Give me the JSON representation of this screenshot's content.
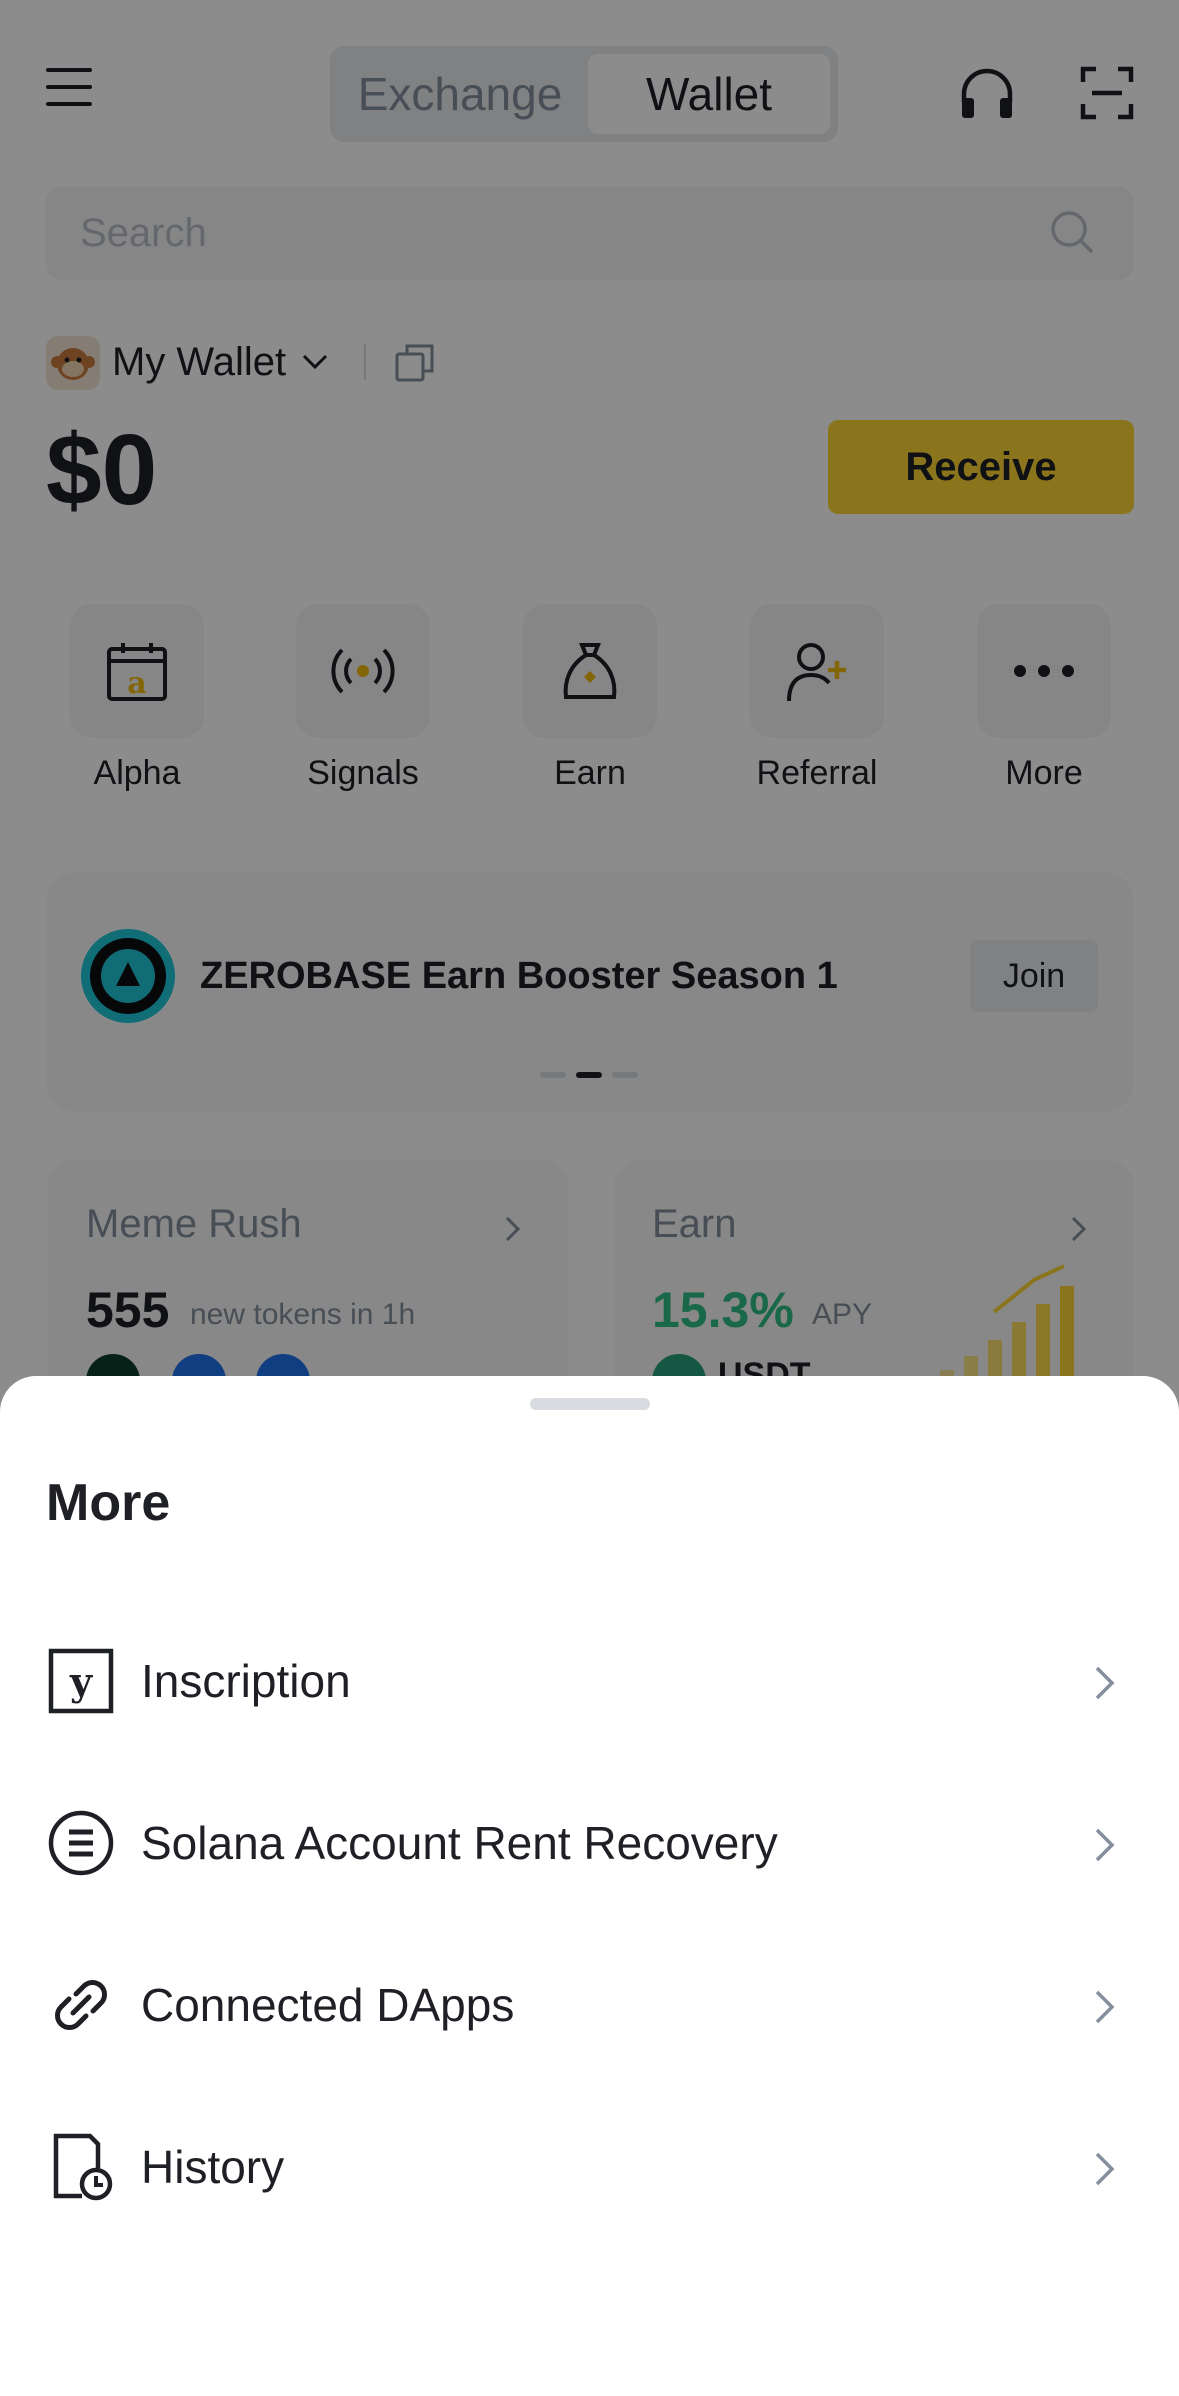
{
  "topbar": {
    "tabs": [
      {
        "label": "Exchange",
        "active": false
      },
      {
        "label": "Wallet",
        "active": true
      }
    ]
  },
  "search": {
    "placeholder": "Search"
  },
  "wallet": {
    "name": "My Wallet",
    "balance": "$0",
    "receive_label": "Receive"
  },
  "shortcuts": [
    {
      "label": "Alpha",
      "icon": "calendar-alpha-icon"
    },
    {
      "label": "Signals",
      "icon": "signals-icon"
    },
    {
      "label": "Earn",
      "icon": "money-bag-icon"
    },
    {
      "label": "Referral",
      "icon": "add-user-icon"
    },
    {
      "label": "More",
      "icon": "more-dots-icon"
    }
  ],
  "banner": {
    "title": "ZEROBASE Earn Booster Season 1",
    "join_label": "Join",
    "page_count": 3,
    "active_page": 1
  },
  "cards": {
    "meme": {
      "title": "Meme Rush",
      "value": "555",
      "sub": "new tokens in 1h"
    },
    "earn": {
      "title": "Earn",
      "value": "15.3%",
      "sub": "APY",
      "coin": "USDT"
    }
  },
  "sheet": {
    "title": "More",
    "items": [
      {
        "label": "Inscription",
        "icon": "inscription-icon"
      },
      {
        "label": "Solana Account Rent Recovery",
        "icon": "solana-icon"
      },
      {
        "label": "Connected DApps",
        "icon": "link-icon"
      },
      {
        "label": "History",
        "icon": "history-icon"
      }
    ]
  },
  "colors": {
    "accent": "#fcd535",
    "positive": "#2ebd85",
    "text": "#1e2026",
    "muted": "#848e9c"
  }
}
